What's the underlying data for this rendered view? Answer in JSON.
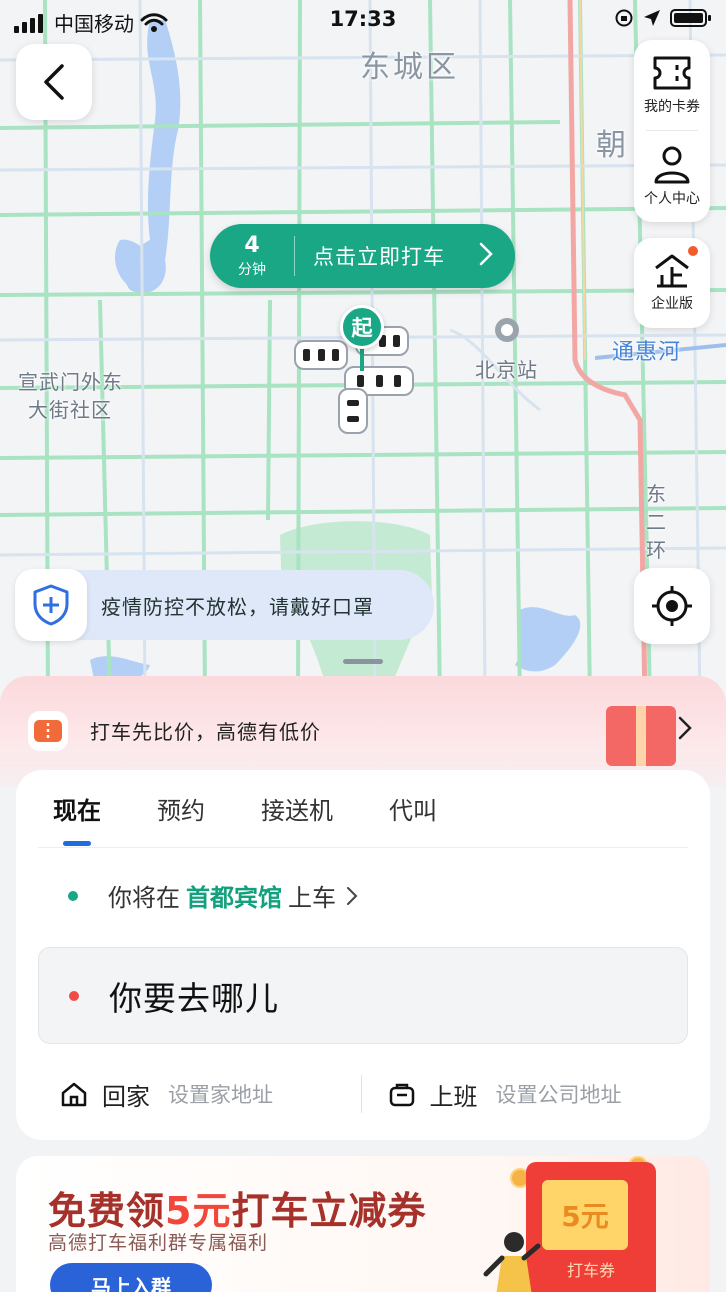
{
  "status_bar": {
    "carrier": "中国移动",
    "time": "17:33"
  },
  "map": {
    "labels": {
      "district": "东城区",
      "chaoyang_partial": "朝",
      "xuanwu_line1": "宣武门外东",
      "xuanwu_line2": "大街社区",
      "station": "北京站",
      "river": "通惠河",
      "ring_line1": "东",
      "ring_line2": "二",
      "ring_line3": "环"
    },
    "start_marker": "起",
    "eta": {
      "value": "4",
      "unit": "分钟",
      "action": "点击立即打车"
    }
  },
  "side_buttons": {
    "coupons": "我的卡券",
    "profile": "个人中心",
    "enterprise": "企业版"
  },
  "notice": {
    "text": "疫情防控不放松，请戴好口罩"
  },
  "promo_strip": {
    "text": "打车先比价，高德有低价"
  },
  "booking": {
    "tabs": [
      "现在",
      "预约",
      "接送机",
      "代叫"
    ],
    "active_tab": "现在",
    "pickup": {
      "prefix": "你将在",
      "place": "首都宾馆",
      "suffix": "上车"
    },
    "destination_placeholder": "你要去哪儿",
    "shortcuts": {
      "home": {
        "name": "回家",
        "hint": "设置家地址"
      },
      "work": {
        "name": "上班",
        "hint": "设置公司地址"
      }
    }
  },
  "ad": {
    "title_prefix": "免费领",
    "title_highlight": "5元",
    "title_suffix": "打车立减券",
    "subtitle": "高德打车福利群专属福利",
    "button": "马上入群",
    "envelope_value": "5元",
    "envelope_label": "打车券"
  },
  "colors": {
    "accent_green": "#1aa785",
    "tab_indicator": "#1f6be0",
    "destination_dot": "#f04b45",
    "ad_red": "#f2463a"
  }
}
